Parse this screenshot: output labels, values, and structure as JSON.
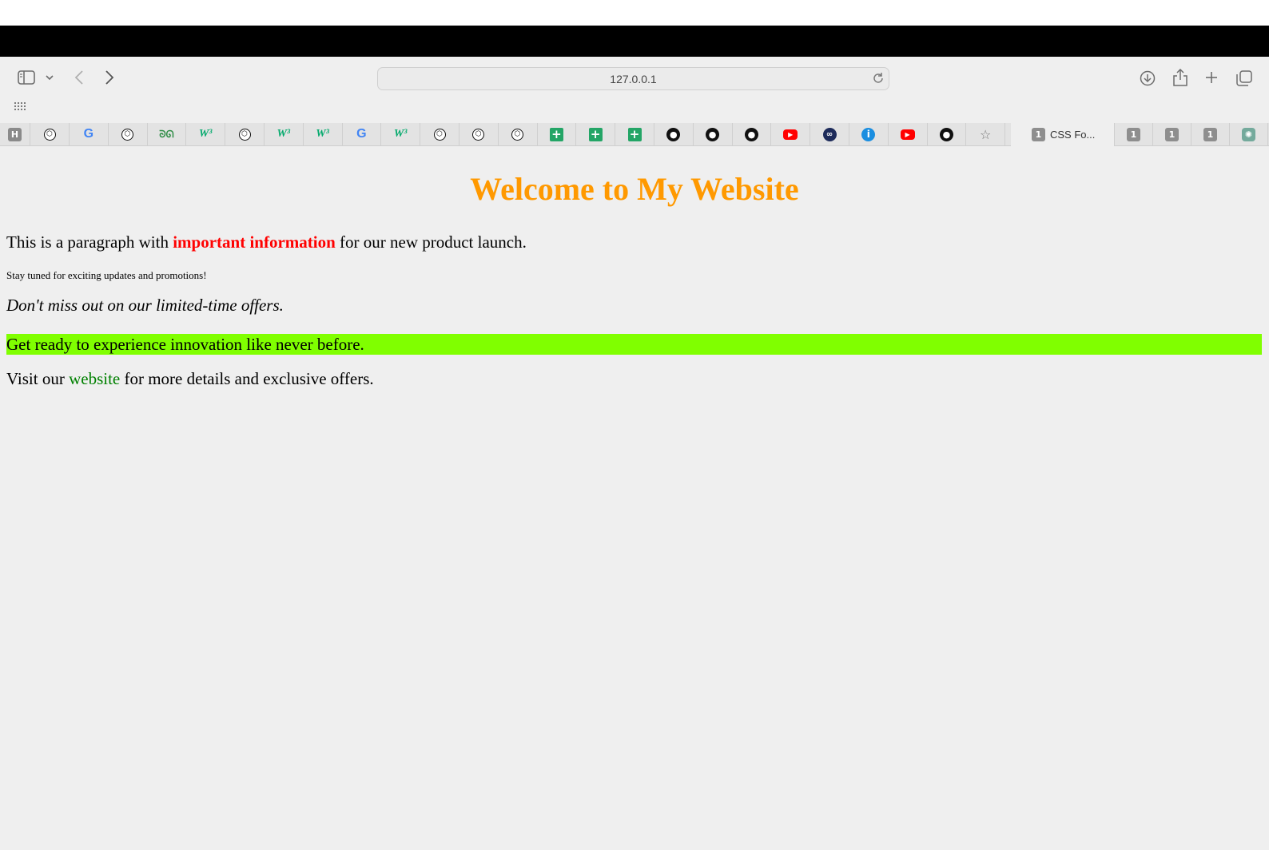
{
  "browser": {
    "address_url": "127.0.0.1",
    "tabs": [
      {
        "icon": "hacker-news-icon",
        "glyph": "H"
      },
      {
        "icon": "codepen-icon",
        "glyph": "⬡"
      },
      {
        "icon": "google-icon",
        "glyph": "G"
      },
      {
        "icon": "codepen-icon",
        "glyph": "⬡"
      },
      {
        "icon": "geeksforgeeks-icon",
        "glyph": "ᘐᘏ"
      },
      {
        "icon": "w3schools-icon",
        "glyph": "W³"
      },
      {
        "icon": "codepen-icon",
        "glyph": "⬡"
      },
      {
        "icon": "w3schools-icon",
        "glyph": "W³"
      },
      {
        "icon": "w3schools-icon",
        "glyph": "W³"
      },
      {
        "icon": "google-icon",
        "glyph": "G"
      },
      {
        "icon": "w3schools-icon",
        "glyph": "W³"
      },
      {
        "icon": "codepen-icon",
        "glyph": "⬡"
      },
      {
        "icon": "codepen-icon",
        "glyph": "⬡"
      },
      {
        "icon": "codepen-icon",
        "glyph": "⬡"
      },
      {
        "icon": "google-sheets-icon",
        "glyph": "+"
      },
      {
        "icon": "google-sheets-icon",
        "glyph": "+"
      },
      {
        "icon": "google-sheets-icon",
        "glyph": "+"
      },
      {
        "icon": "github-icon",
        "glyph": "●"
      },
      {
        "icon": "github-icon",
        "glyph": "●"
      },
      {
        "icon": "github-icon",
        "glyph": "●"
      },
      {
        "icon": "youtube-icon",
        "glyph": "▶"
      },
      {
        "icon": "loop-icon",
        "glyph": "∞"
      },
      {
        "icon": "info-icon",
        "glyph": "i"
      },
      {
        "icon": "youtube-icon",
        "glyph": "▶"
      },
      {
        "icon": "github-icon",
        "glyph": "●"
      },
      {
        "icon": "star-icon",
        "glyph": "☆"
      }
    ],
    "active_tab": {
      "icon": "onepassword-icon",
      "glyph": "1",
      "title": "CSS Fo..."
    },
    "right_tabs": [
      {
        "icon": "onepassword-icon",
        "glyph": "1"
      },
      {
        "icon": "onepassword-icon",
        "glyph": "1"
      },
      {
        "icon": "onepassword-icon",
        "glyph": "1"
      },
      {
        "icon": "chatgpt-icon",
        "glyph": "✺"
      }
    ]
  },
  "page": {
    "heading": "Welcome to My Website",
    "p1_before": "This is a paragraph with ",
    "p1_important": "important information",
    "p1_after": " for our new product launch.",
    "p2": "Stay tuned for exciting updates and promotions!",
    "p3": "Don't miss out on our limited-time offers.",
    "p4": "Get ready to experience innovation like never before.",
    "p5_before": "Visit our ",
    "p5_link": "website",
    "p5_after": " for more details and exclusive offers."
  },
  "colors": {
    "heading": "#ff9900",
    "important": "#ff0000",
    "highlight_bg": "#80ff00",
    "link": "#008000",
    "page_bg": "#efefef"
  }
}
